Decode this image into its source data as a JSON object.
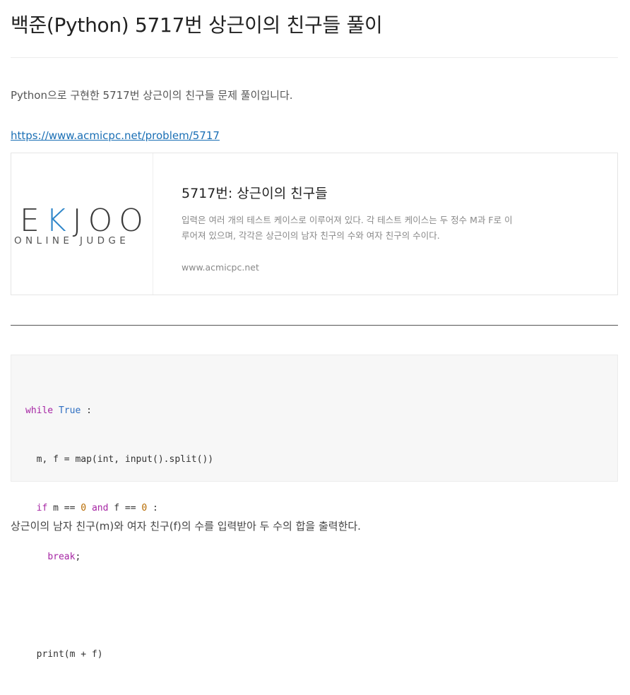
{
  "post": {
    "title": "백준(Python) 5717번 상근이의 친구들 풀이",
    "intro": "Python으로 구현한 5717번 상근이의 친구들 문제 풀이입니다.",
    "link": "https://www.acmicpc.net/problem/5717",
    "outro": "상근이의 남자 친구(m)와 여자 친구(f)의 수를 입력받아 두 수의 합을 출력한다."
  },
  "og_card": {
    "logo_main_left": "E",
    "logo_main_accent": "K",
    "logo_main_right": "JOO",
    "logo_sub": "ONLINE JUDGE",
    "title": "5717번: 상근이의 친구들",
    "description": "입력은 여러 개의 테스트 케이스로 이루어져 있다. 각 테스트 케이스는 두 정수 M과 F로 이루어져 있으며, 각각은 상근이의 남자 친구의 수와 여자 친구의 수이다.",
    "url": "www.acmicpc.net"
  },
  "code": {
    "line1": {
      "kw": "while",
      "sp1": " ",
      "lit": "True",
      "rest": " :"
    },
    "line2": {
      "text": "  m, f = map(int, input().split())"
    },
    "line3": {
      "indent": "  ",
      "kw1": "if",
      "a": " m == ",
      "n1": "0",
      "sp": " ",
      "kw2": "and",
      "b": " f == ",
      "n2": "0",
      "c": " :"
    },
    "line4": {
      "indent": "    ",
      "kw": "break",
      "rest": ";"
    },
    "line5": {
      "text": ""
    },
    "line6": {
      "text": "  print(m + f)"
    }
  },
  "colors": {
    "keyword": "#a626a4",
    "literal": "#2f6fc2",
    "number": "#b76b01",
    "link": "#1a6fb5",
    "logo_accent": "#2f86c9"
  }
}
